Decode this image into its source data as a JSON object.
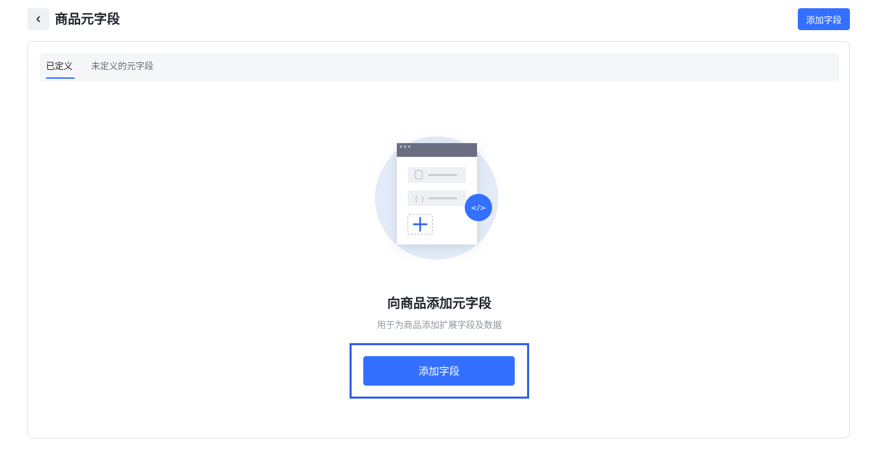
{
  "header": {
    "title": "商品元字段",
    "add_button_label": "添加字段",
    "back_icon": "chevron-left-icon"
  },
  "tabs": [
    {
      "label": "已定义",
      "active": true
    },
    {
      "label": "未定义的元字段",
      "active": false
    }
  ],
  "empty_state": {
    "title": "向商品添加元字段",
    "description": "用于为商品添加扩展字段及数据",
    "button_label": "添加字段",
    "illustration_code_glyph": "</>"
  },
  "colors": {
    "primary": "#3370ff",
    "highlight_border": "#2f5fe9",
    "tab_bar_bg": "#f5f6f8"
  }
}
